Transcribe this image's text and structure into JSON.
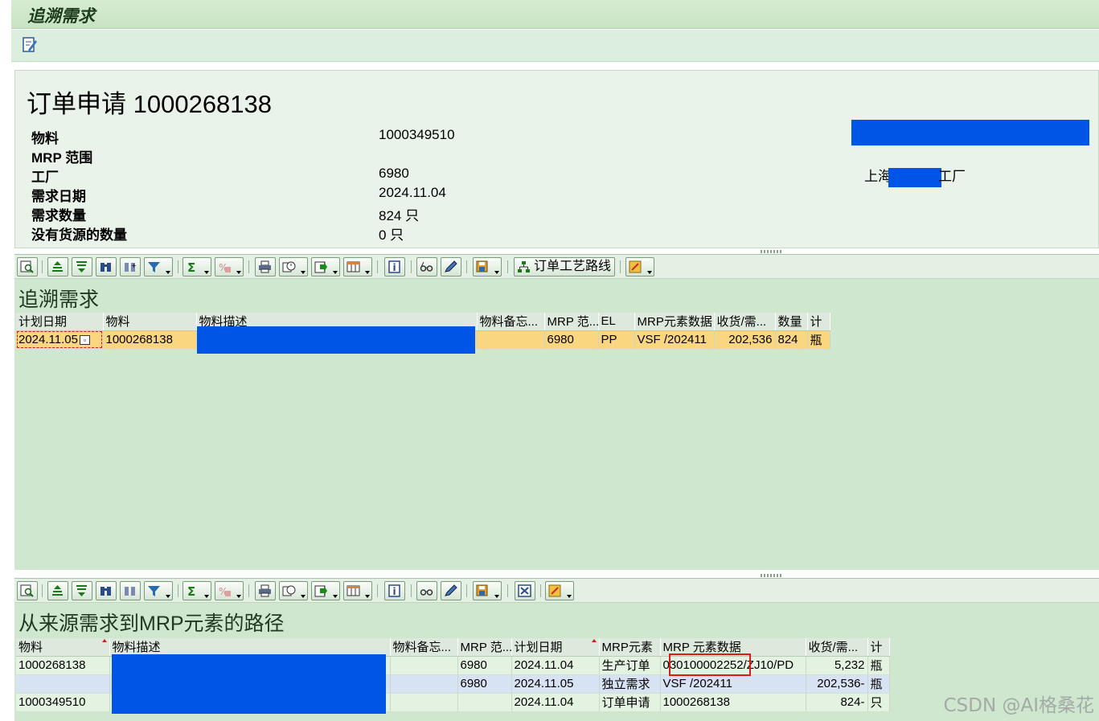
{
  "window": {
    "title": "追溯需求"
  },
  "header": {
    "doc_title": "订单申请 1000268138",
    "fields": [
      {
        "label": "物料",
        "value": "1000349510"
      },
      {
        "label": "MRP 范围",
        "value": ""
      },
      {
        "label": "工厂",
        "value": "6980"
      },
      {
        "label": "需求日期",
        "value": "2024.11.04"
      },
      {
        "label": "需求数量",
        "value": "824 只"
      },
      {
        "label": "没有货源的数量",
        "value": "0 只"
      }
    ],
    "plant_name_prefix": "上海",
    "plant_name_suffix": "工厂"
  },
  "toolbar": {
    "routing_button": "订单工艺路线",
    "icons": [
      "details-icon",
      "sort-asc-icon",
      "sort-desc-icon",
      "find-icon",
      "find-next-icon",
      "filter-icon",
      "sum-icon",
      "subtotal-icon",
      "print-icon",
      "views-icon",
      "export-icon",
      "layout-icon",
      "info-icon",
      "glasses-icon",
      "pencil-icon",
      "save-layout-icon",
      "routing-icon",
      "exceptions-icon",
      "close-window-icon"
    ]
  },
  "section1": {
    "title": "追溯需求",
    "columns": [
      "计划日期",
      "物料",
      "物料描述",
      "物料备忘...",
      "MRP 范...",
      "EL",
      "MRP元素数据",
      "收货/需...",
      "数量",
      "计"
    ],
    "rows": [
      [
        "2024.11.05",
        "1000268138",
        "",
        "",
        "6980",
        "PP",
        "VSF /202411",
        "202,536",
        "824",
        "瓶"
      ]
    ]
  },
  "section2": {
    "title": "从来源需求到MRP元素的路径",
    "columns": [
      "物料",
      "物料描述",
      "物料备忘...",
      "MRP 范...",
      "计划日期",
      "MRP元素",
      "MRP 元素数据",
      "收货/需...",
      "计"
    ],
    "rows": [
      [
        "1000268138",
        "",
        "",
        "6980",
        "2024.11.04",
        "生产订单",
        "030100002252/ZJ10/PD",
        "5,232",
        "瓶"
      ],
      [
        "",
        "",
        "",
        "6980",
        "2024.11.05",
        "独立需求",
        "VSF /202411",
        "202,536-",
        "瓶"
      ],
      [
        "1000349510",
        "",
        "",
        "",
        "2024.11.04",
        "订单申请",
        "1000268138",
        "824-",
        "只"
      ]
    ]
  },
  "watermark": "CSDN @AI格桑花",
  "colors": {
    "redaction": "#0055e6",
    "row_highlight": "#fbd681",
    "section_bg": "#cfe6cf"
  }
}
